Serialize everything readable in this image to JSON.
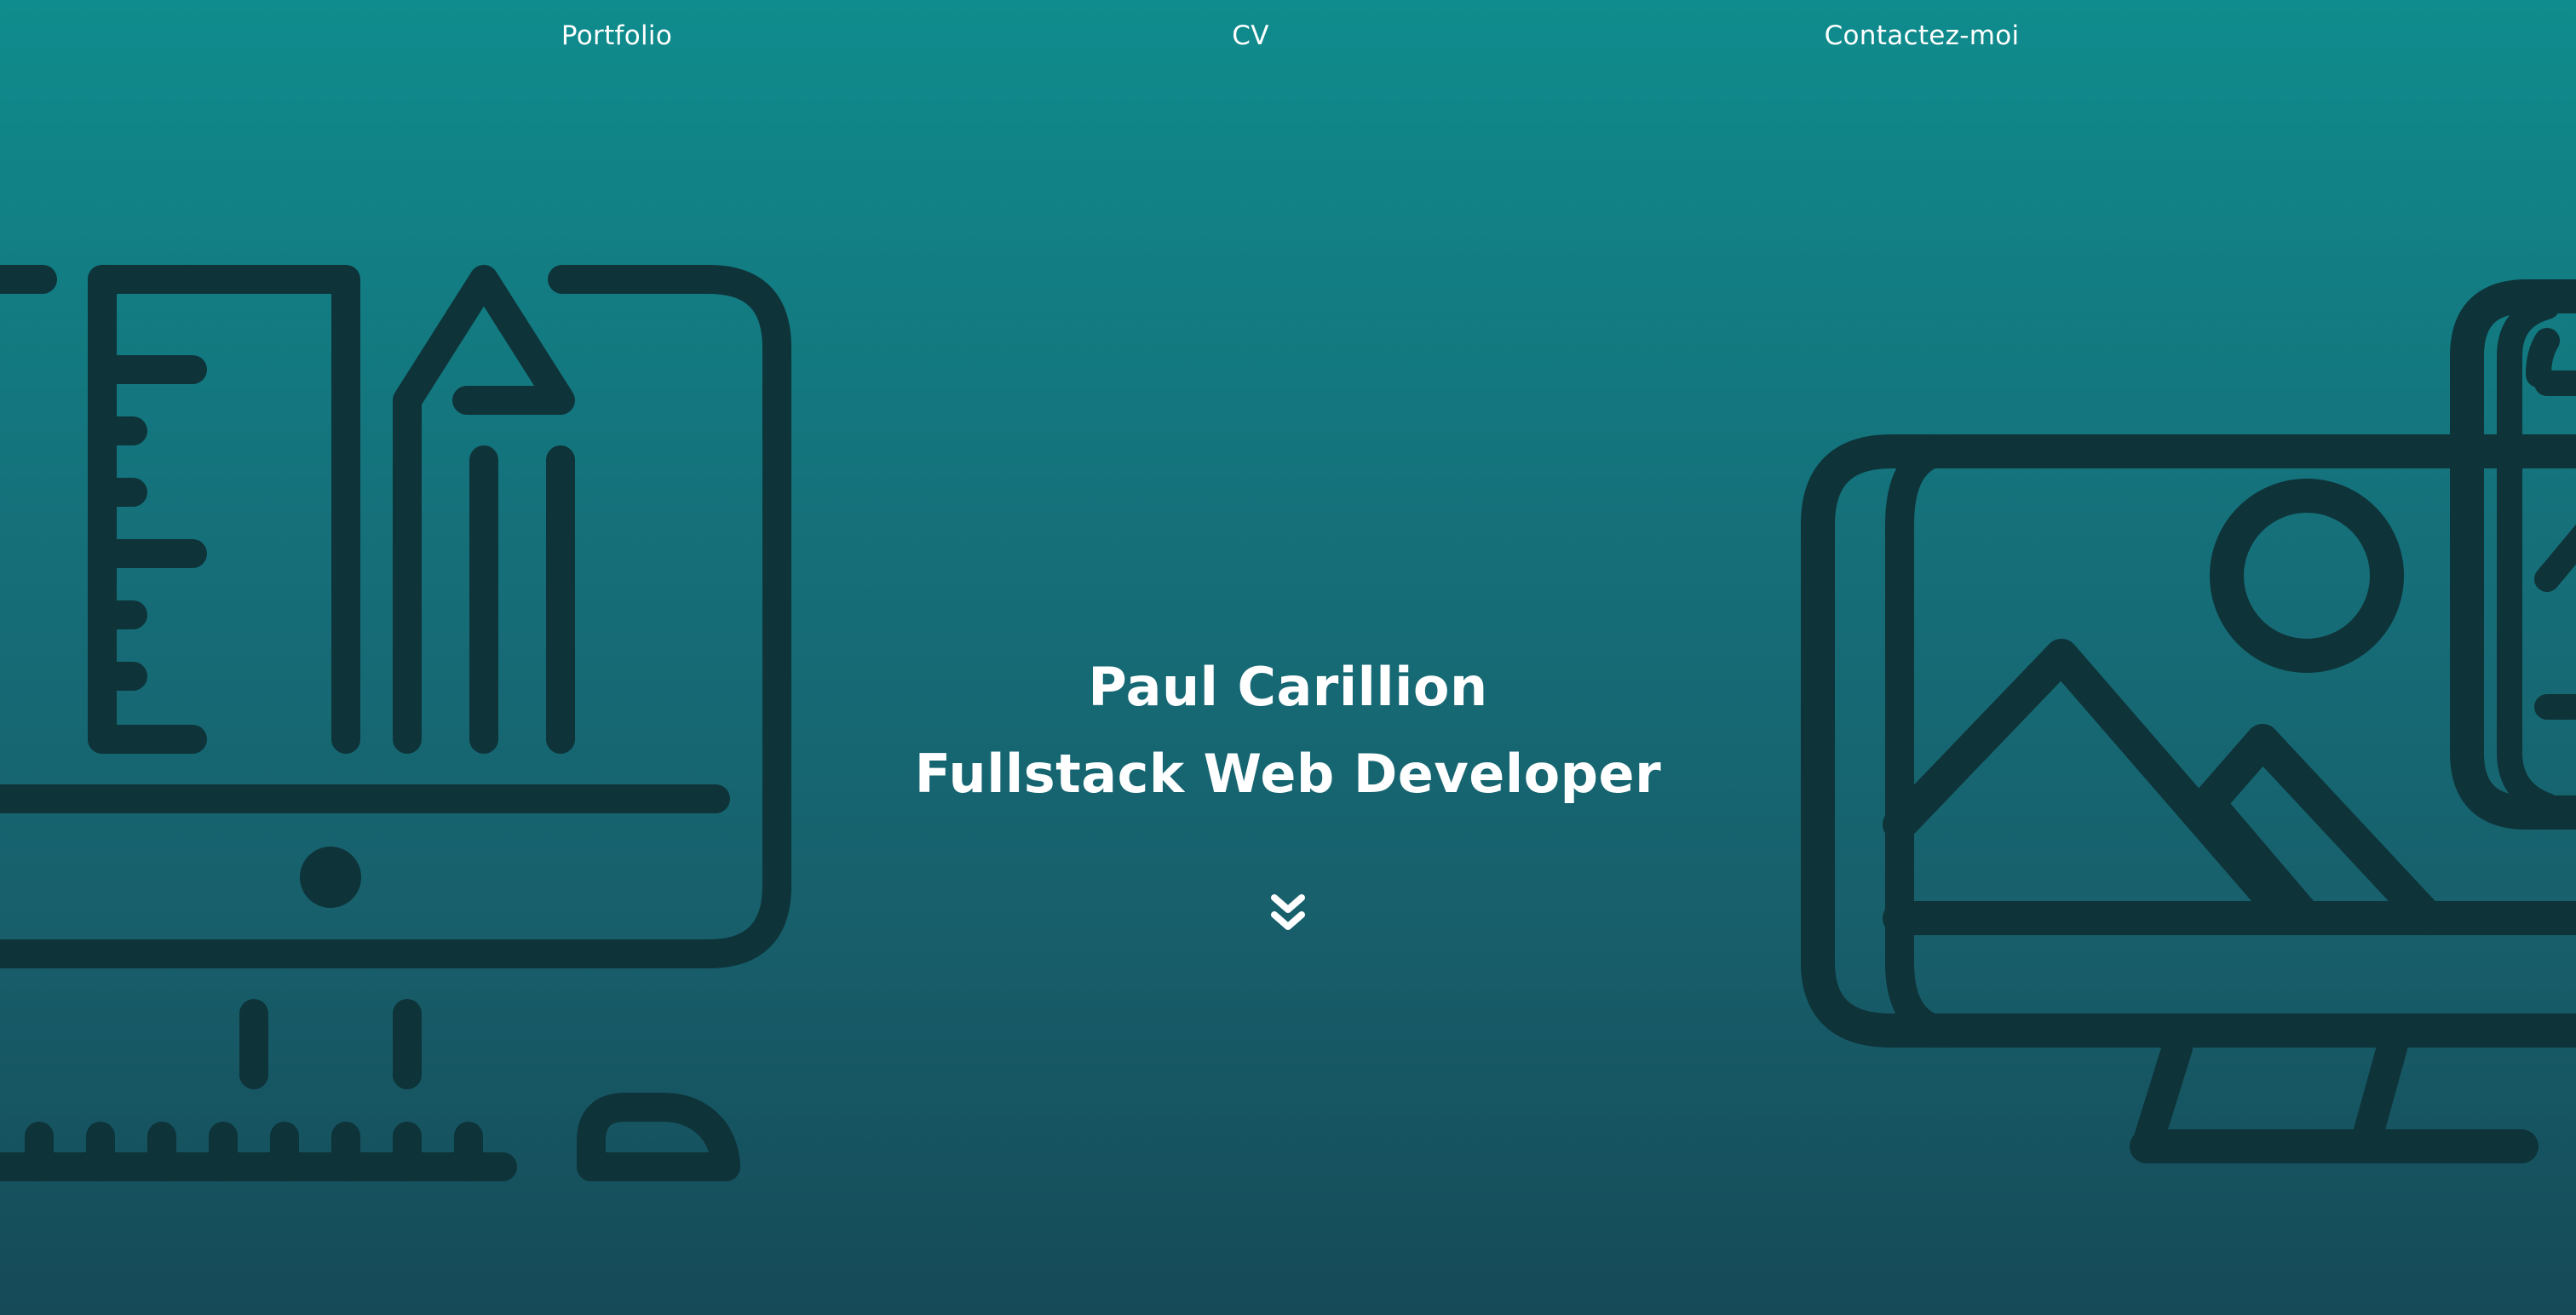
{
  "nav": {
    "items": [
      {
        "label": "Portfolio"
      },
      {
        "label": "CV"
      },
      {
        "label": "Contactez-moi"
      }
    ]
  },
  "hero": {
    "name": "Paul Carillion",
    "role": "Fullstack Web Developer",
    "scroll_icon": "double-chevron-down-icon",
    "gradient_top": "#0f8c8d",
    "gradient_bottom": "#164a58",
    "illustration_color": "#0e3338",
    "left_illustration": "design-workstation-illustration",
    "right_illustration": "image-gallery-monitor-illustration"
  }
}
